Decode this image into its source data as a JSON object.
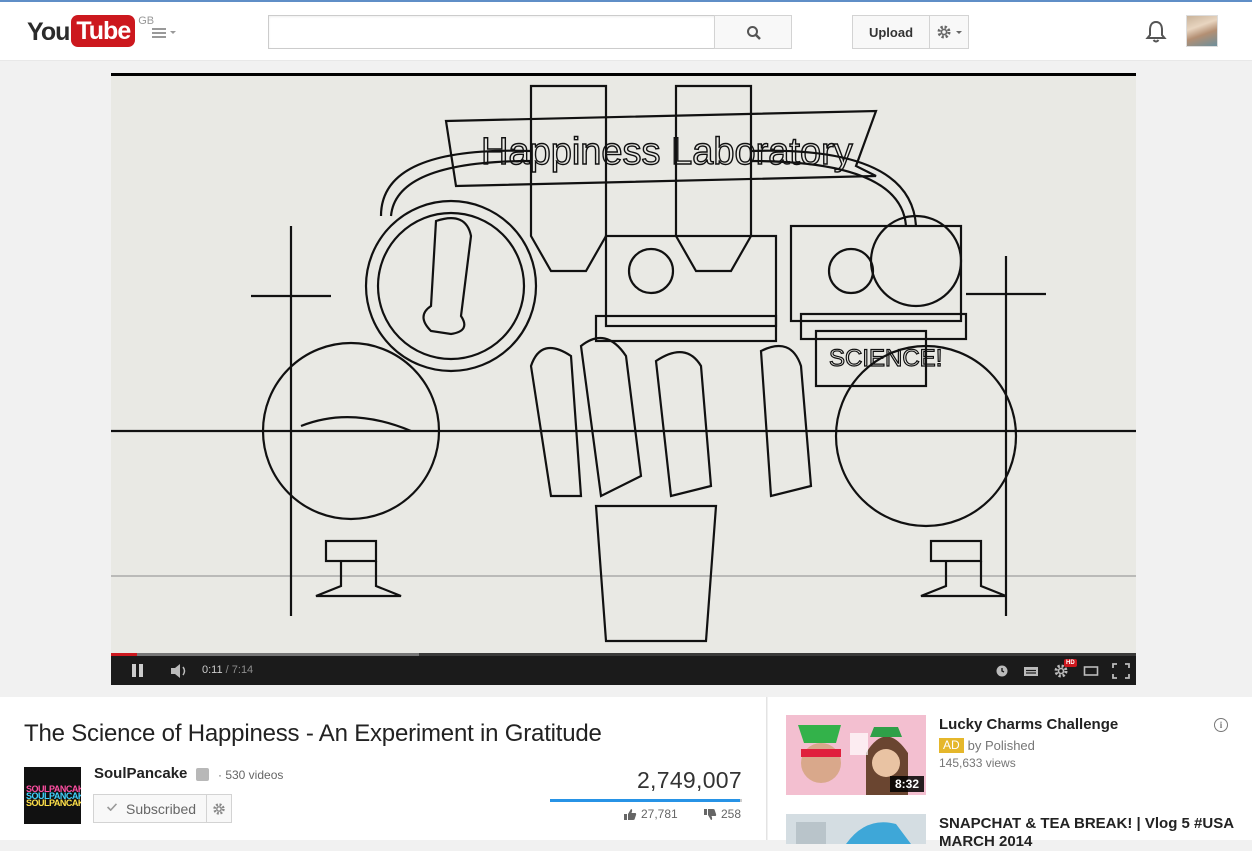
{
  "header": {
    "logo_you": "You",
    "logo_tube": "Tube",
    "region": "GB",
    "search_placeholder": "",
    "upload_label": "Upload"
  },
  "player": {
    "current_time": "0:11",
    "duration": "/ 7:14",
    "hd_label": "HD",
    "progress_played_fraction": 0.025,
    "progress_loaded_fraction": 0.3,
    "video_text": {
      "banner": "Happiness Laboratory",
      "sign": "SCIENCE!"
    }
  },
  "video": {
    "title": "The Science of Happiness - An Experiment in Gratitude",
    "channel_name": "SoulPancake",
    "channel_avatar_text": [
      "SOULPANCAKE",
      "SOULPANCAKE",
      "SOULPANCAKE"
    ],
    "video_count": "· 530 videos",
    "subscribe_label": "Subscribed",
    "views": "2,749,007",
    "likes": "27,781",
    "dislikes": "258"
  },
  "sidebar": {
    "items": [
      {
        "title": "Lucky Charms Challenge",
        "ad_label": "AD",
        "byline": "by Polished",
        "views": "145,633 views",
        "duration": "8:32"
      },
      {
        "title": "SNAPCHAT & TEA BREAK! | Vlog 5 #USA MARCH 2014"
      }
    ]
  },
  "colors": {
    "brand_red": "#cc181e",
    "like_blue": "#2793e6",
    "ad_yellow": "#e5b72b"
  }
}
